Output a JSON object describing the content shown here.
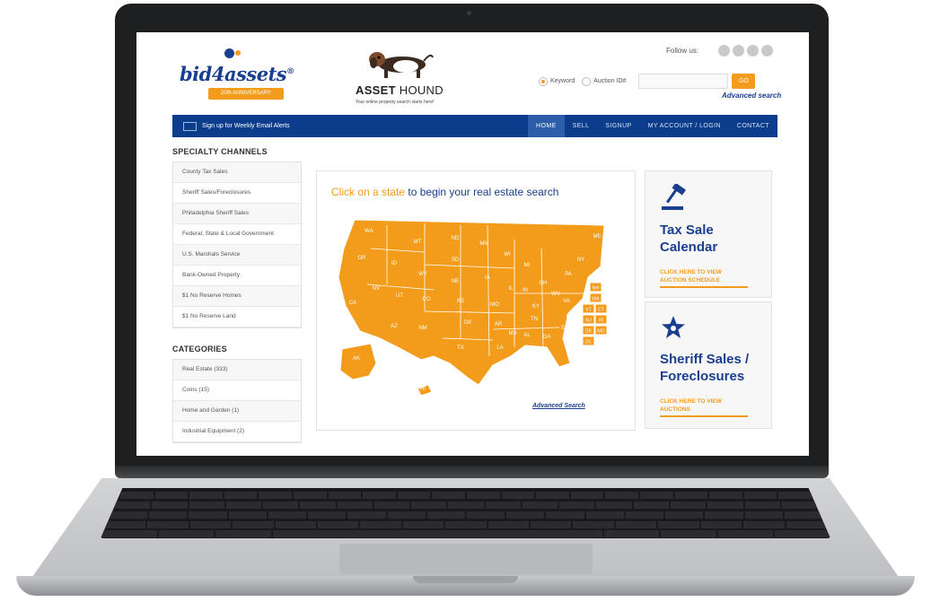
{
  "header": {
    "brand_word": "bid4assets",
    "brand_reg": "®",
    "brand_ribbon": "20th ANNIVERSARY",
    "hound_name_bold": "ASSET",
    "hound_name_light": "HOUND",
    "hound_tagline": "Your online property search starts here!",
    "follow_label": "Follow us:",
    "search": {
      "radio_keyword": "Keyword",
      "radio_auction": "Auction ID#",
      "go_label": "GO",
      "advanced_link": "Advanced search"
    }
  },
  "nav": {
    "email_alert": "Sign up for Weekly Email Alerts",
    "items": [
      "HOME",
      "SELL",
      "SIGNUP",
      "MY ACCOUNT / LOGIN",
      "CONTACT"
    ]
  },
  "sidebar": {
    "specialty_title": "SPECIALTY CHANNELS",
    "specialty": [
      "County Tax Sales",
      "Sheriff Sales/Foreclosures",
      "Philadelphia Sheriff Sales",
      "Federal, State & Local Government",
      "U.S. Marshals Service",
      "Bank-Owned Property",
      "$1 No Reserve Homes",
      "$1 No Reserve Land"
    ],
    "categories_title": "CATEGORIES",
    "categories": [
      "Real Estate (333)",
      "Coins (15)",
      "Home and Garden (1)",
      "Industrial Equipment (2)"
    ]
  },
  "map": {
    "heading_highlight": "Click on a state",
    "heading_rest": " to begin your real estate search",
    "advanced_link": "Advanced Search",
    "state_labels": [
      "WA",
      "OR",
      "CA",
      "NV",
      "ID",
      "MT",
      "WY",
      "UT",
      "AZ",
      "CO",
      "NM",
      "ND",
      "SD",
      "NE",
      "KS",
      "OK",
      "TX",
      "MN",
      "IA",
      "MO",
      "AR",
      "LA",
      "WI",
      "IL",
      "MS",
      "MI",
      "IN",
      "KY",
      "TN",
      "AL",
      "GA",
      "FL",
      "OH",
      "WV",
      "VA",
      "NC",
      "SC",
      "PA",
      "NY",
      "ME",
      "AK",
      "HI"
    ],
    "small_states": [
      "NH",
      "MA",
      "VT",
      "CT",
      "NJ",
      "RI",
      "DE",
      "MD",
      "DC"
    ],
    "colors": {
      "state_fill": "#f39c1c",
      "state_stroke": "#ffffff"
    }
  },
  "cards": [
    {
      "title": "Tax Sale Calendar",
      "cta": "CLICK HERE TO VIEW AUCTION SCHEDULE",
      "icon": "gavel-icon"
    },
    {
      "title": "Sheriff Sales / Foreclosures",
      "cta": "CLICK HERE TO VIEW AUCTIONS",
      "icon": "sheriff-badge-icon"
    }
  ],
  "colors": {
    "brand_blue": "#1b3f8f",
    "nav_blue": "#0b3d8c",
    "accent_orange": "#f39c1c"
  }
}
